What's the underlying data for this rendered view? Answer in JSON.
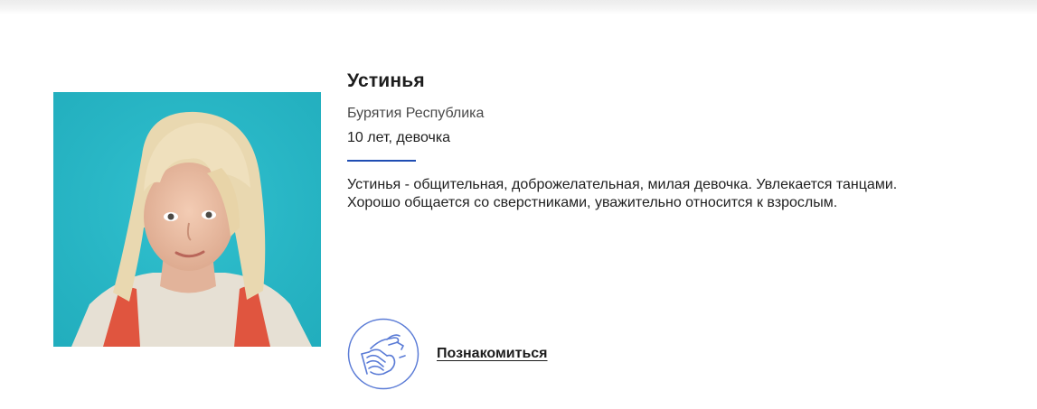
{
  "child": {
    "name": "Устинья",
    "region": "Бурятия Республика",
    "age_gender": "10 лет, девочка",
    "description": "Устинья - общительная, доброжелательная, милая девочка. Увлекается танцами. Хорошо общается со сверстниками, уважительно относится к взрослым."
  },
  "actions": {
    "meet_label": "Познакомиться",
    "meet_icon": "handshake-icon"
  },
  "colors": {
    "accent": "#1f4db3",
    "icon_stroke": "#5a7bd6",
    "photo_background": "#2bbac9"
  }
}
